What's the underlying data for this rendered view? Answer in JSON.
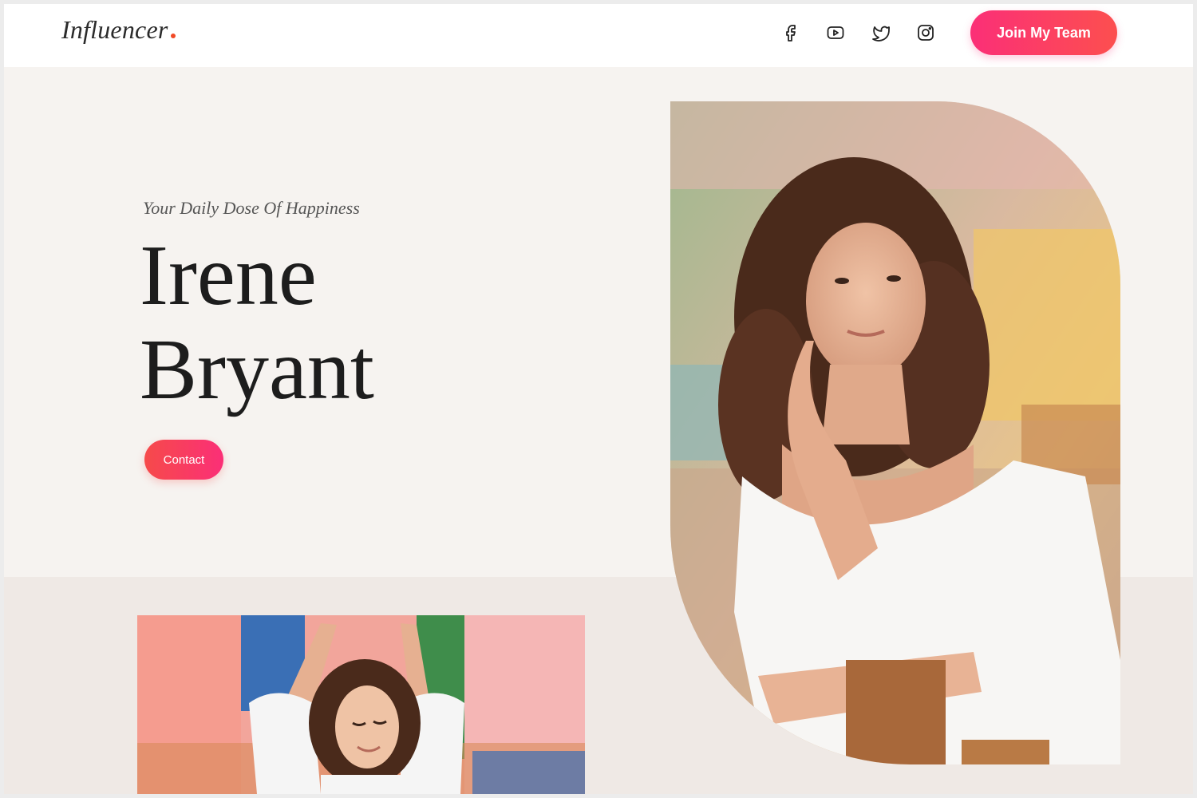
{
  "header": {
    "logo_text": "Influencer",
    "logo_dot_color": "#f14a26",
    "social_icons": [
      "facebook-icon",
      "youtube-icon",
      "twitter-icon",
      "instagram-icon"
    ],
    "cta_label": "Join My Team"
  },
  "hero": {
    "tagline": "Your Daily Dose Of Happiness",
    "name_line1": "Irene",
    "name_line2": "Bryant",
    "contact_label": "Contact",
    "photo_subject": "woman with curly hair in white off-shoulder dress resting chin on hand"
  },
  "gallery": {
    "photo_subject": "woman with curly hair stretching arms up in front of colorful painted wall"
  },
  "colors": {
    "accent_pink": "#fb2f77",
    "accent_orange": "#fc4f4f",
    "background": "#f6f3f0",
    "band": "#efe9e5"
  }
}
